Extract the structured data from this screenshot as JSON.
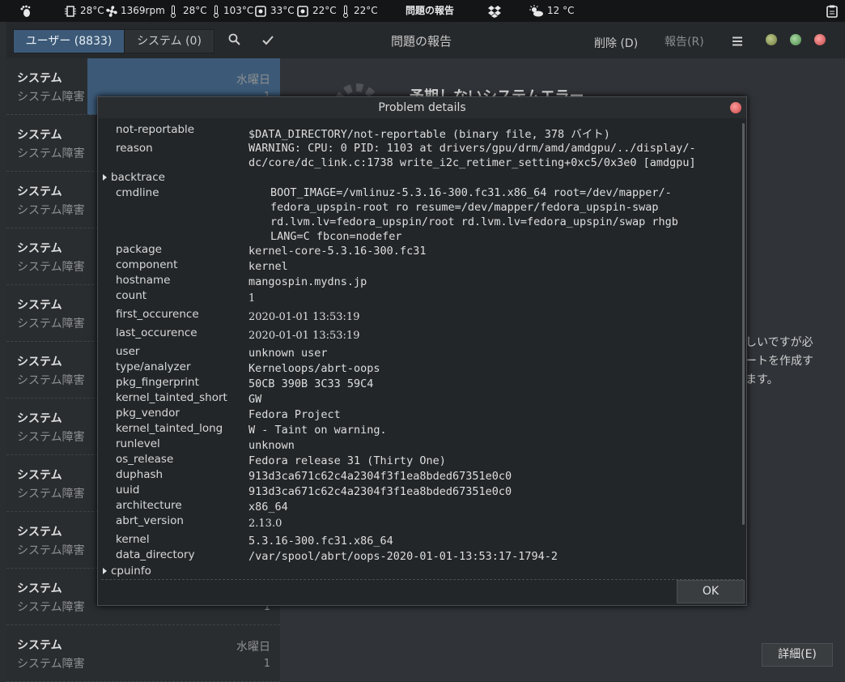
{
  "topbar": {
    "cpu_temp": "28°C",
    "fan": "1369rpm",
    "t2": "28°C",
    "t3": "103°C",
    "t4": "33°C",
    "t5": "22°C",
    "t6": "22°C",
    "problem_report": "問題の報告",
    "weather": "12 °C",
    "icons": [
      "gnome-foot-icon",
      "chip-icon",
      "fan-icon",
      "thermometer-icon",
      "drive-icon",
      "dropbox-icon",
      "weather-icon",
      "clipboard-icon"
    ]
  },
  "app": {
    "tabs": [
      "ユーザー (8833)",
      "システム (0)"
    ],
    "header_title": "問題の報告",
    "delete": "削除 (D)",
    "report": "報告(R)",
    "bg_heading": "予期しないシステムエラー",
    "bg_text": [
      "しいですが必",
      "ートを作成す",
      "ます。"
    ],
    "details_button": "詳細(E)",
    "rows": [
      {
        "title": "システム",
        "sub": "システム障害",
        "day": "水曜日",
        "count": "1"
      },
      {
        "title": "システム",
        "sub": "システム障害",
        "day": "",
        "count": ""
      },
      {
        "title": "システム",
        "sub": "システム障害",
        "day": "",
        "count": ""
      },
      {
        "title": "システム",
        "sub": "システム障害",
        "day": "",
        "count": ""
      },
      {
        "title": "システム",
        "sub": "システム障害",
        "day": "",
        "count": ""
      },
      {
        "title": "システム",
        "sub": "システム障害",
        "day": "",
        "count": ""
      },
      {
        "title": "システム",
        "sub": "システム障害",
        "day": "",
        "count": ""
      },
      {
        "title": "システム",
        "sub": "システム障害",
        "day": "",
        "count": ""
      },
      {
        "title": "システム",
        "sub": "システム障害",
        "day": "",
        "count": ""
      },
      {
        "title": "システム",
        "sub": "システム障害",
        "day": "",
        "count": "1"
      },
      {
        "title": "システム",
        "sub": "システム障害",
        "day": "水曜日",
        "count": "1"
      }
    ],
    "accent_color": "#3c5a78"
  },
  "dialog": {
    "title": "Problem details",
    "ok": "OK",
    "backtrace_label": "backtrace",
    "cpuinfo_label": "cpuinfo",
    "not_reportable_key": "not-reportable",
    "not_reportable_val": "$DATA_DIRECTORY/not-reportable (binary file, 378 バイト)",
    "reason_key": "reason",
    "reason_val": "WARNING: CPU: 0 PID: 1103 at drivers/gpu/drm/amd/amdgpu/../display/-\ndc/core/dc_link.c:1738 write_i2c_retimer_setting+0xc5/0x3e0 [amdgpu]",
    "cmdline_key": "cmdline",
    "cmdline_val": "BOOT_IMAGE=/vmlinuz-5.3.16-300.fc31.x86_64 root=/dev/mapper/-\nfedora_upspin-root ro resume=/dev/mapper/fedora_upspin-swap\nrd.lvm.lv=fedora_upspin/root rd.lvm.lv=fedora_upspin/swap rhgb\nLANG=C fbcon=nodefer",
    "fields": [
      {
        "key": "package",
        "val": "kernel-core-5.3.16-300.fc31"
      },
      {
        "key": "component",
        "val": "kernel"
      },
      {
        "key": "hostname",
        "val": "mangospin.mydns.jp"
      },
      {
        "key": "count",
        "val": "1"
      },
      {
        "key": "first_occurence",
        "val": "2020-01-01 13:53:19"
      },
      {
        "key": "last_occurence",
        "val": "2020-01-01 13:53:19"
      },
      {
        "key": "user",
        "val": "unknown user"
      },
      {
        "key": "type/analyzer",
        "val": "Kerneloops/abrt-oops"
      },
      {
        "key": "pkg_fingerprint",
        "val": "50CB 390B 3C33 59C4"
      },
      {
        "key": "kernel_tainted_short",
        "val": "GW"
      },
      {
        "key": "pkg_vendor",
        "val": "Fedora Project"
      },
      {
        "key": "kernel_tainted_long",
        "val": "W - Taint on warning."
      },
      {
        "key": "runlevel",
        "val": "unknown"
      },
      {
        "key": "os_release",
        "val": "Fedora release 31 (Thirty One)"
      },
      {
        "key": "duphash",
        "val": "913d3ca671c62c4a2304f3f1ea8bded67351e0c0"
      },
      {
        "key": "uuid",
        "val": "913d3ca671c62c4a2304f3f1ea8bded67351e0c0"
      },
      {
        "key": "architecture",
        "val": "x86_64"
      },
      {
        "key": "abrt_version",
        "val": "2.13.0"
      },
      {
        "key": "kernel",
        "val": "5.3.16-300.fc31.x86_64"
      },
      {
        "key": "data_directory",
        "val": "/var/spool/abrt/oops-2020-01-01-13:53:17-1794-2"
      }
    ]
  }
}
